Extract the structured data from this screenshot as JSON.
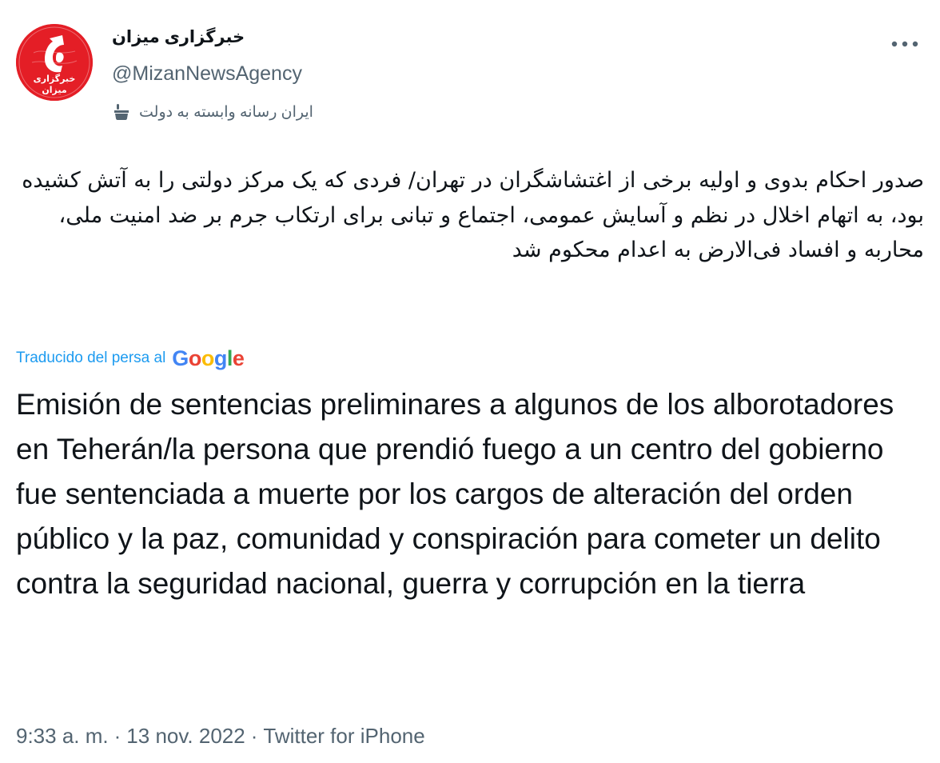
{
  "author": {
    "name": "خبرگزاری میزان",
    "handle": "@MizanNewsAgency",
    "affiliation": "ایران رسانه وابسته به دولت",
    "avatar_text_line1": "خبرگزاری",
    "avatar_text_line2": "میزان",
    "avatar_color": "#e41e26"
  },
  "icons": {
    "more": "more-options-icon",
    "affiliation": "state-media-podium-icon"
  },
  "tweet": {
    "original_text": "صدور احکام بدوی و اولیه برخی از اغتشاشگران در تهران/ فردی که یک مرکز دولتی را به آتش کشیده بود، به اتهام اخلال در نظم و آسایش عمومی، اجتماع و تبانی برای ارتکاب جرم بر ضد امنیت ملی،  محاربه و افساد فی‌الارض به اعدام محکوم شد",
    "translated_by_label": "Traducido del persa al",
    "translation_provider_letters": [
      "G",
      "o",
      "o",
      "g",
      "l",
      "e"
    ],
    "translation_provider_colors": [
      "#4285f4",
      "#ea4335",
      "#fbbc05",
      "#4285f4",
      "#34a853",
      "#ea4335"
    ],
    "translated_text": "Emisión de sentencias preliminares a algunos de los alborotadores en Teherán/la persona que prendió fuego a un centro del gobierno fue sentenciada a muerte por los cargos de alteración del orden público y la paz, comunidad y conspiración para cometer un delito contra la seguridad nacional, guerra y corrupción en la tierra"
  },
  "meta": {
    "time": "9:33 a. m.",
    "separator": "·",
    "date": "13 nov. 2022",
    "source": "Twitter for iPhone"
  },
  "colors": {
    "text_primary": "#0f1419",
    "text_secondary": "#536471",
    "link_blue": "#1d9bf0"
  }
}
